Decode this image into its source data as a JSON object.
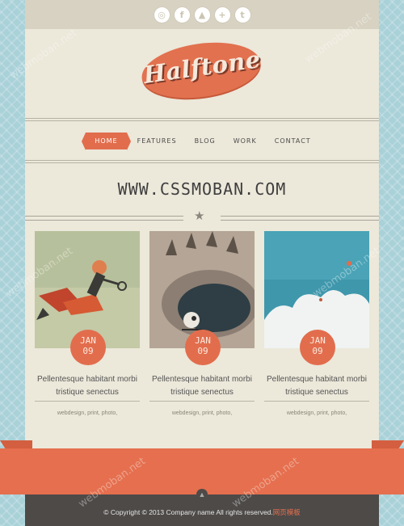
{
  "social": [
    {
      "icon": "dribbble-icon",
      "glyph": "◎"
    },
    {
      "icon": "facebook-icon",
      "glyph": "f"
    },
    {
      "icon": "triangle-icon",
      "glyph": "▲"
    },
    {
      "icon": "plus-icon",
      "glyph": "+"
    },
    {
      "icon": "twitter-icon",
      "glyph": "t"
    }
  ],
  "logo": {
    "text": "Halftone"
  },
  "nav": [
    "HOME",
    "FEATURES",
    "BLOG",
    "WORK",
    "CONTACT"
  ],
  "tagline": "WWW.CSSMOBAN.COM",
  "cards": [
    {
      "month": "JAN",
      "day": "09",
      "title_line1": "Pellentesque habitant morbi",
      "title_line2": "tristique senectus",
      "tags": "webdesign, print, photo,"
    },
    {
      "month": "JAN",
      "day": "09",
      "title_line1": "Pellentesque habitant morbi",
      "title_line2": "tristique senectus",
      "tags": "webdesign, print, photo,"
    },
    {
      "month": "JAN",
      "day": "09",
      "title_line1": "Pellentesque habitant morbi",
      "title_line2": "tristique senectus",
      "tags": "webdesign, print, photo,"
    }
  ],
  "footer": {
    "copyright": "© Copyright © 2013 Company name All rights reserved.",
    "link": "网页模板"
  },
  "watermark": "webmoban.net",
  "colors": {
    "accent": "#e26d4d",
    "page": "#ece8da",
    "background": "#a9d1d8",
    "footer": "#4d4a48"
  }
}
